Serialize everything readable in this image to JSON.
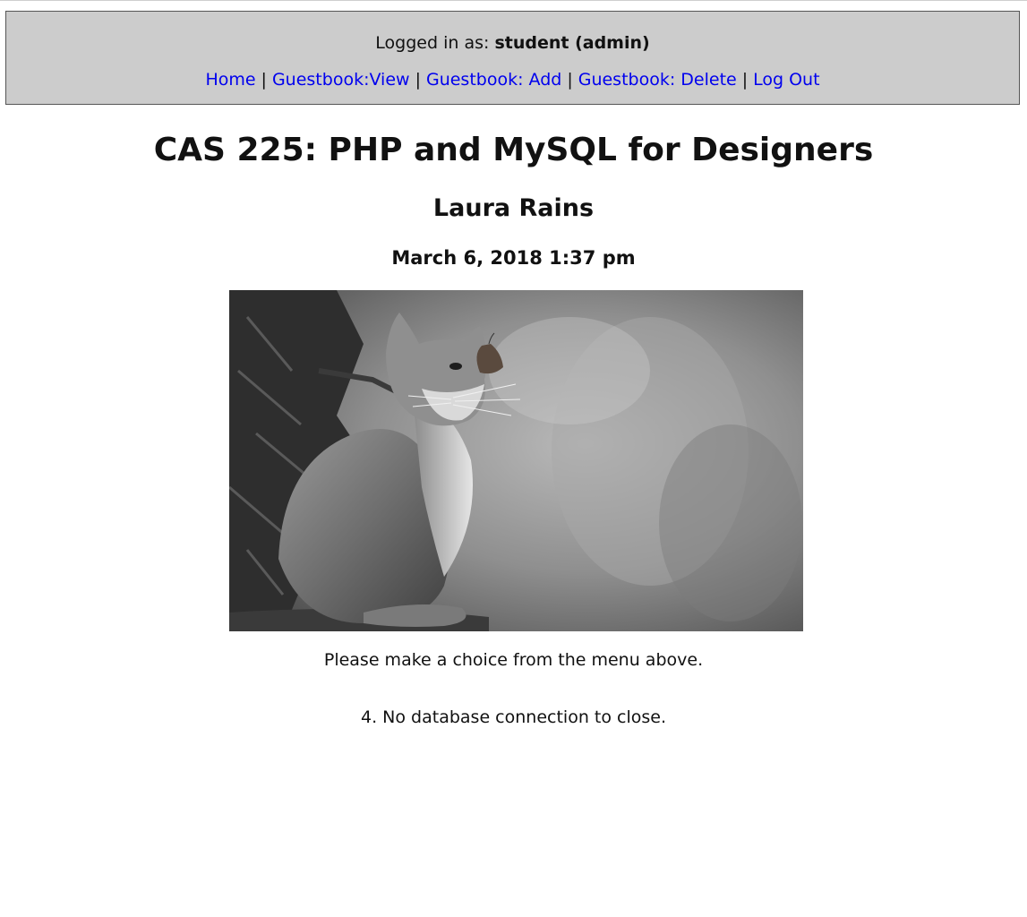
{
  "header": {
    "logged_in_prefix": "Logged in as:",
    "user": "student (admin)"
  },
  "nav": {
    "items": [
      {
        "label": "Home"
      },
      {
        "label": "Guestbook:View"
      },
      {
        "label": "Guestbook: Add"
      },
      {
        "label": "Guestbook: Delete"
      },
      {
        "label": "Log Out"
      }
    ],
    "separator": "|"
  },
  "main": {
    "title": "CAS 225: PHP and MySQL for Designers",
    "author": "Laura Rains",
    "datetime": "March 6, 2018 1:37 pm",
    "image": {
      "description_icon": "kitten-with-butterfly-photo"
    },
    "message": "Please make a choice from the menu above.",
    "db_message": "4. No database connection to close."
  },
  "colors": {
    "header_bg": "#cccccc",
    "link": "#0000ee"
  }
}
